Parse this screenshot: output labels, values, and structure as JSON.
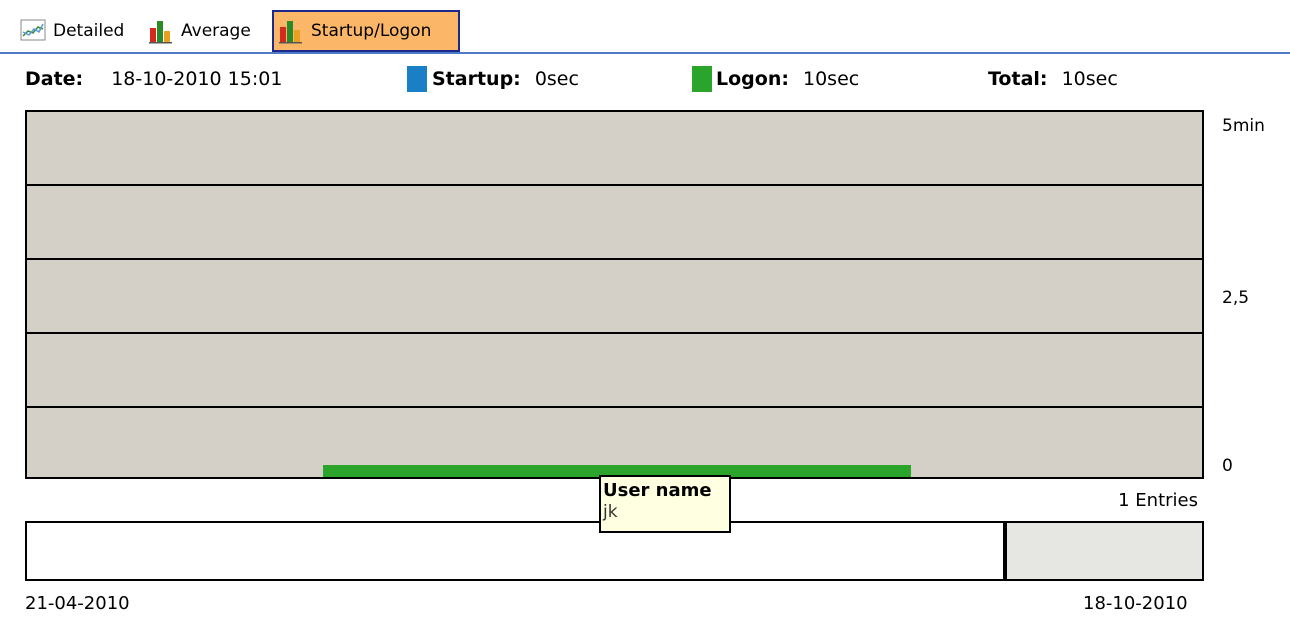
{
  "tabs": [
    {
      "label": "Detailed",
      "icon": "line-chart-icon",
      "active": false
    },
    {
      "label": "Average",
      "icon": "bar-chart-icon",
      "active": false
    },
    {
      "label": "Startup/Logon",
      "icon": "bar-chart-icon",
      "active": true
    }
  ],
  "info": {
    "date_label": "Date:",
    "date_value": "18-10-2010 15:01",
    "startup_label": "Startup:",
    "startup_value": "0sec",
    "logon_label": "Logon:",
    "logon_value": "10sec",
    "total_label": "Total:",
    "total_value": "10sec"
  },
  "colors": {
    "startup": "#1a7fc4",
    "logon": "#2aa42a",
    "plot_bg": "#d4d0c8",
    "active_tab": "#fbb767"
  },
  "chart_data": {
    "type": "bar",
    "series": [
      {
        "name": "Logon",
        "value_sec": 10
      },
      {
        "name": "Startup",
        "value_sec": 0
      }
    ],
    "y_ticks": [
      "5min",
      "2,5",
      "0"
    ],
    "ylim_min": [
      0,
      5
    ],
    "grid": true
  },
  "entries_text": "1 Entries",
  "range": {
    "start_date": "21-04-2010",
    "end_date": "18-10-2010"
  },
  "tooltip": {
    "title": "User name",
    "value": "jk"
  }
}
